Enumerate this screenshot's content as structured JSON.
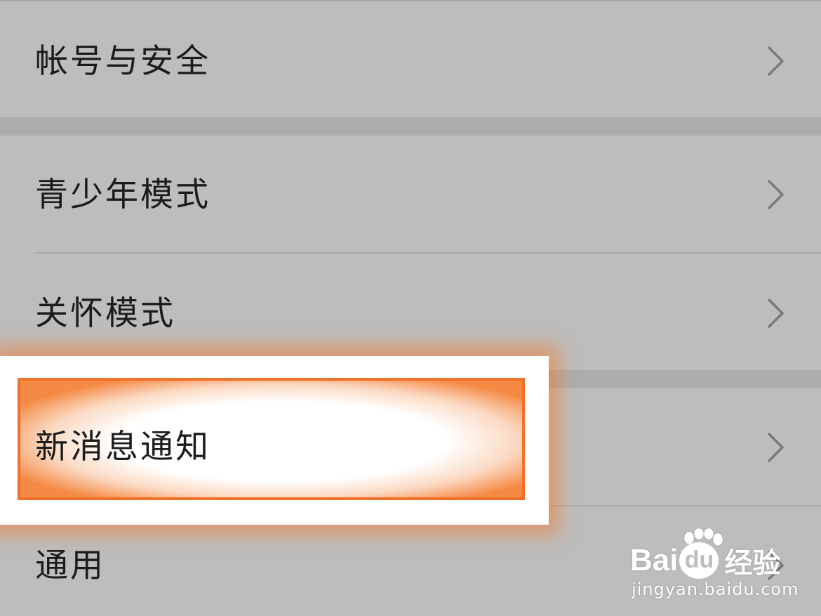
{
  "settings": {
    "items": [
      {
        "label": "帐号与安全",
        "icon": "chevron-right-icon"
      },
      {
        "label": "青少年模式",
        "icon": "chevron-right-icon"
      },
      {
        "label": "关怀模式",
        "icon": "chevron-right-icon"
      },
      {
        "label": "新消息通知",
        "icon": "chevron-right-icon",
        "highlighted": true
      },
      {
        "label": "通用",
        "icon": "chevron-right-icon"
      }
    ]
  },
  "highlight": {
    "color": "#f2712a"
  },
  "watermark": {
    "brand_latin_a": "Bai",
    "brand_latin_b": "du",
    "brand_cn": "经验",
    "url": "jingyan.baidu.com"
  },
  "colors": {
    "background": "#bdbdbd",
    "separator": "#adadad",
    "text": "#1c1c1c",
    "chevron": "#7a7a7a"
  }
}
